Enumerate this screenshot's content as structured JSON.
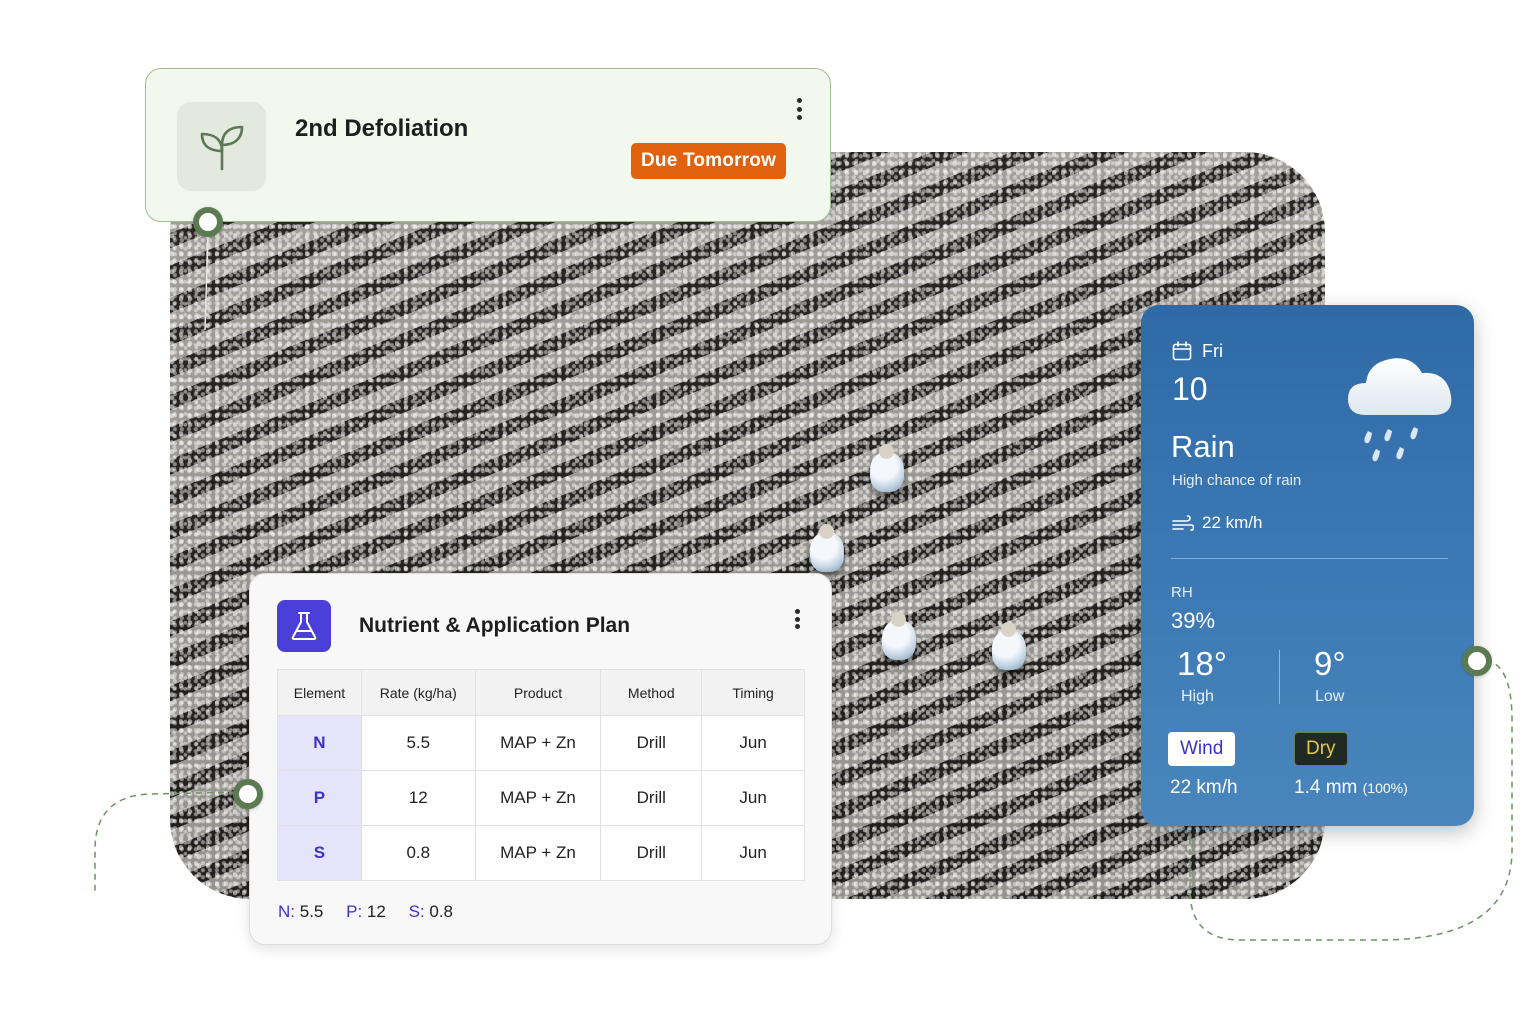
{
  "task": {
    "title": "2nd Defoliation",
    "badge": "Due Tomorrow",
    "icon": "sprout-icon",
    "badge_color": "#e1620e"
  },
  "nutrient_plan": {
    "title": "Nutrient & Application Plan",
    "icon": "flask-icon",
    "columns": [
      "Element",
      "Rate (kg/ha)",
      "Product",
      "Method",
      "Timing"
    ],
    "rows": [
      {
        "element": "N",
        "rate": "5.5",
        "product": "MAP + Zn",
        "method": "Drill",
        "timing": "Jun"
      },
      {
        "element": "P",
        "rate": "12",
        "product": "MAP + Zn",
        "method": "Drill",
        "timing": "Jun"
      },
      {
        "element": "S",
        "rate": "0.8",
        "product": "MAP + Zn",
        "method": "Drill",
        "timing": "Jun"
      }
    ],
    "summary": [
      {
        "key": "N:",
        "value": "5.5"
      },
      {
        "key": "P:",
        "value": "12"
      },
      {
        "key": "S:",
        "value": "0.8"
      }
    ],
    "accent_color": "#4a3fd8"
  },
  "weather": {
    "day": "Fri",
    "date": "10",
    "condition": "Rain",
    "description": "High chance of rain",
    "wind_speed": "22 km/h",
    "rh_label": "RH",
    "rh_value": "39%",
    "high": "18°",
    "high_label": "High",
    "low": "9°",
    "low_label": "Low",
    "wind_badge": "Wind",
    "wind_value": "22 km/h",
    "dry_badge": "Dry",
    "rain_amount": "1.4 mm",
    "rain_pct": "(100%)",
    "icons": [
      "calendar-icon",
      "rain-cloud-icon",
      "wind-icon"
    ],
    "card_color": "#3a77b3"
  },
  "accent_green": "#5b7a52"
}
